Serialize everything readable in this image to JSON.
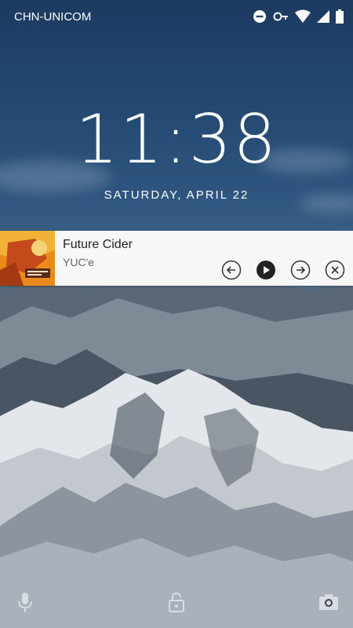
{
  "status_bar": {
    "carrier": "CHN-UNICOM",
    "icons": [
      "dnd-icon",
      "key-icon",
      "wifi-icon",
      "signal-icon",
      "battery-icon"
    ]
  },
  "lockscreen": {
    "time": "11:38",
    "date": "SATURDAY, APRIL 22"
  },
  "media_notification": {
    "title": "Future Cider",
    "artist": "YUC'e",
    "controls": [
      "previous-icon",
      "play-icon",
      "next-icon",
      "close-icon"
    ]
  },
  "bottom_shortcuts": [
    "mic-icon",
    "unlock-icon",
    "camera-icon"
  ]
}
